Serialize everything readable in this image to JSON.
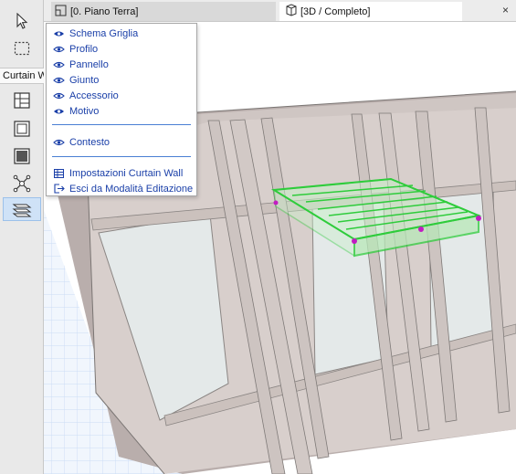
{
  "toolbox": {
    "label": "Curtain W",
    "tools": [
      {
        "icon": "arrow-pointer-icon"
      },
      {
        "icon": "marquee-icon"
      },
      {
        "icon": "grid-scheme-icon"
      },
      {
        "icon": "frame-icon"
      },
      {
        "icon": "panel-icon"
      },
      {
        "icon": "junction-icon"
      },
      {
        "icon": "accessory-icon"
      }
    ]
  },
  "tabs": [
    {
      "label": "[0. Piano Terra]",
      "icon": "floor-plan-icon"
    },
    {
      "label": "[3D / Completo]",
      "icon": "cube-3d-icon"
    }
  ],
  "close_glyph": "×",
  "menu": {
    "items": [
      {
        "label": "Schema Griglia",
        "icon": "eye-closed-icon"
      },
      {
        "label": "Profilo",
        "icon": "eye-icon"
      },
      {
        "label": "Pannello",
        "icon": "eye-icon"
      },
      {
        "label": "Giunto",
        "icon": "eye-icon"
      },
      {
        "label": "Accessorio",
        "icon": "eye-icon"
      },
      {
        "label": "Motivo",
        "icon": "eye-closed-icon"
      }
    ],
    "context": {
      "label": "Contesto",
      "icon": "eye-icon"
    },
    "actions": [
      {
        "label": "Impostazioni Curtain Wall",
        "icon": "settings-table-icon"
      },
      {
        "label": "Esci da Modalità Editazione",
        "icon": "exit-icon"
      }
    ]
  },
  "colors": {
    "accent": "#1a3fa8",
    "selection": "#2ecc3b",
    "wall": "#d8cfcc",
    "glass": "#e4e9e9",
    "floor_grid": "#a9c6ee"
  }
}
